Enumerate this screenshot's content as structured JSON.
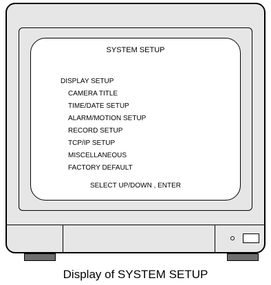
{
  "screen": {
    "title": "SYSTEM SETUP",
    "menu": [
      "DISPLAY SETUP",
      "CAMERA TITLE",
      "TIME/DATE SETUP",
      "ALARM/MOTION SETUP",
      "RECORD SETUP",
      "TCP/IP SETUP",
      "MISCELLANEOUS",
      "FACTORY DEFAULT"
    ],
    "hint": "SELECT UP/DOWN , ENTER"
  },
  "caption": "Display of SYSTEM SETUP",
  "colors": {
    "monitor_body": "#e6e6e6",
    "screen_background": "#ffffff",
    "feet": "#6e6e6e"
  },
  "icons": {
    "power_led": "power-led-icon",
    "power_button": "power-button-icon"
  }
}
